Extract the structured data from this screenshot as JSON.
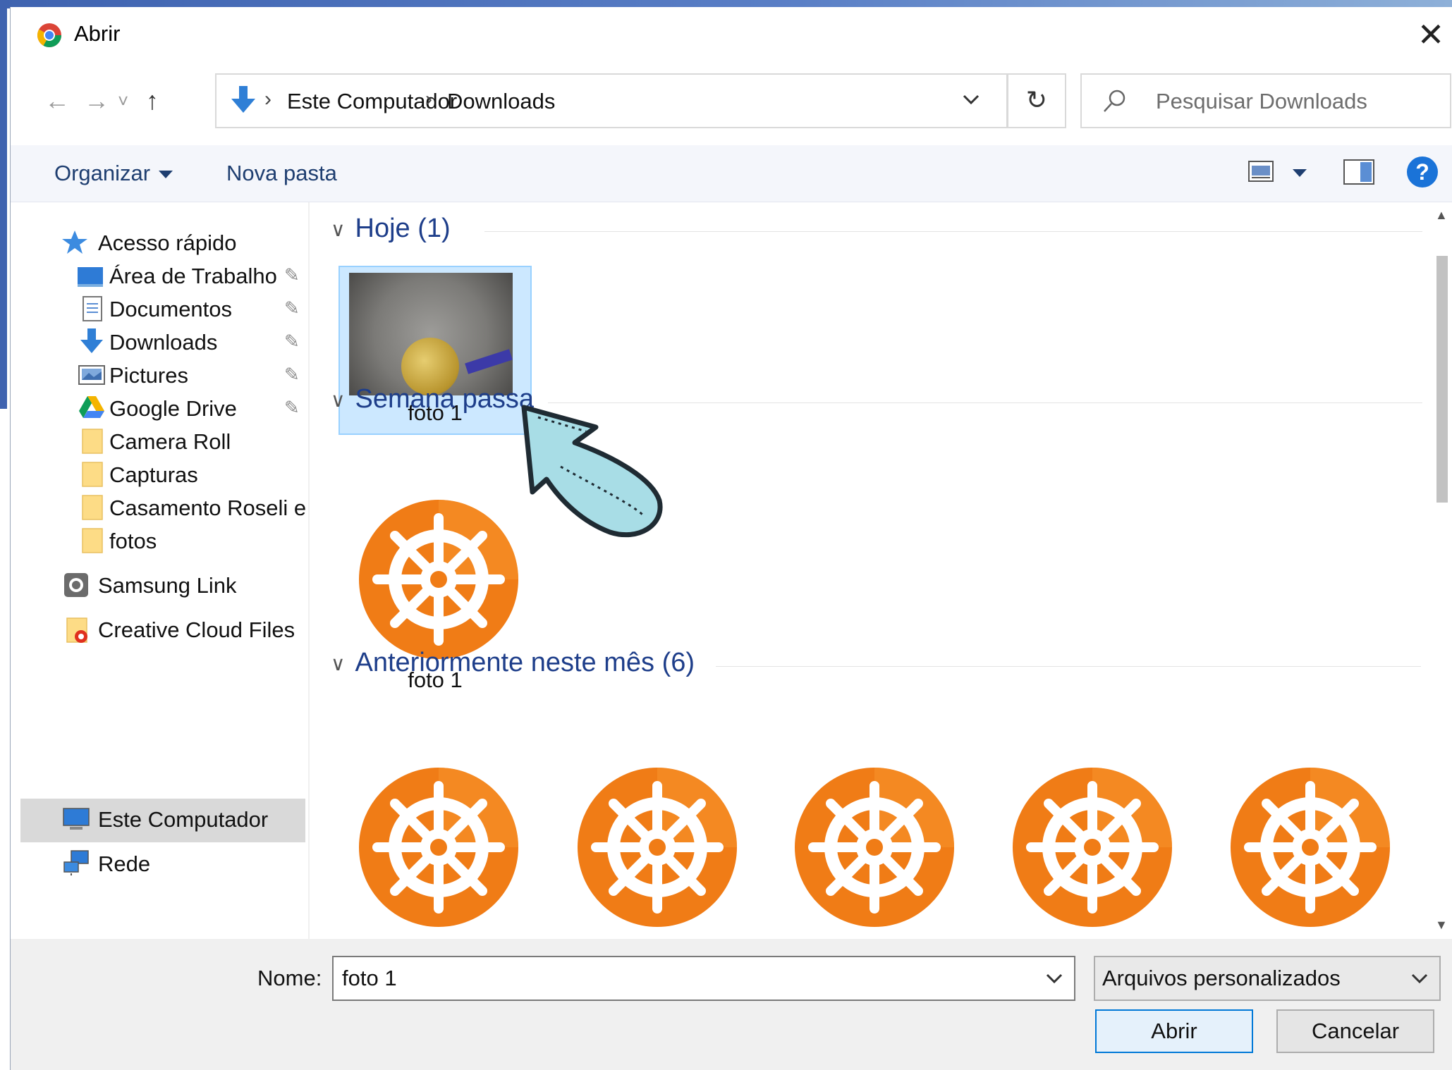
{
  "window": {
    "title": "Abrir",
    "close_glyph": "✕"
  },
  "nav": {
    "back_glyph": "←",
    "forward_glyph": "→",
    "recent_glyph": "˅",
    "up_glyph": "↑",
    "refresh_glyph": "↻",
    "breadcrumb": [
      "Este Computador",
      "Downloads"
    ],
    "crumb_sep": "›",
    "search_placeholder": "Pesquisar Downloads"
  },
  "toolbar": {
    "organize_label": "Organizar",
    "new_folder_label": "Nova pasta",
    "help_glyph": "?"
  },
  "sidebar": {
    "quick_access": "Acesso rápido",
    "items": [
      {
        "label": "Área de Trabalho",
        "icon": "desktop-icon",
        "pinned": true
      },
      {
        "label": "Documentos",
        "icon": "documents-icon",
        "pinned": true
      },
      {
        "label": "Downloads",
        "icon": "downloads-icon",
        "pinned": true
      },
      {
        "label": "Pictures",
        "icon": "pictures-icon",
        "pinned": true
      },
      {
        "label": "Google Drive",
        "icon": "google-drive-icon",
        "pinned": true
      },
      {
        "label": "Camera Roll",
        "icon": "folder-icon",
        "pinned": false
      },
      {
        "label": "Capturas",
        "icon": "folder-icon",
        "pinned": false
      },
      {
        "label": "Casamento Roseli e",
        "icon": "folder-icon",
        "pinned": false
      },
      {
        "label": "fotos",
        "icon": "folder-icon",
        "pinned": false
      }
    ],
    "samsung_link": "Samsung Link",
    "creative_cloud": "Creative Cloud Files",
    "this_pc": "Este Computador",
    "network": "Rede",
    "pin_glyph": "📌"
  },
  "content": {
    "groups": [
      {
        "title": "Hoje (1)",
        "files": [
          {
            "label": "foto 1",
            "type": "photo"
          }
        ]
      },
      {
        "title": "Semana passa",
        "files": [
          {
            "label": "foto 1",
            "type": "helm-icon"
          }
        ]
      },
      {
        "title": "Anteriormente neste mês (6)",
        "files": [
          {
            "label": "",
            "type": "helm-icon"
          },
          {
            "label": "",
            "type": "helm-icon"
          },
          {
            "label": "",
            "type": "helm-icon"
          },
          {
            "label": "",
            "type": "helm-icon"
          },
          {
            "label": "",
            "type": "helm-icon"
          }
        ]
      }
    ],
    "chevron_glyph": "∨"
  },
  "bottom": {
    "name_label": "Nome:",
    "name_value": "foto 1",
    "filter_value": "Arquivos personalizados",
    "open_button": "Abrir",
    "cancel_button": "Cancelar"
  },
  "colors": {
    "accent": "#0078d7",
    "group_header": "#1e3e8a",
    "selection_fill": "#cce8ff",
    "helm_orange": "#f07c16"
  }
}
